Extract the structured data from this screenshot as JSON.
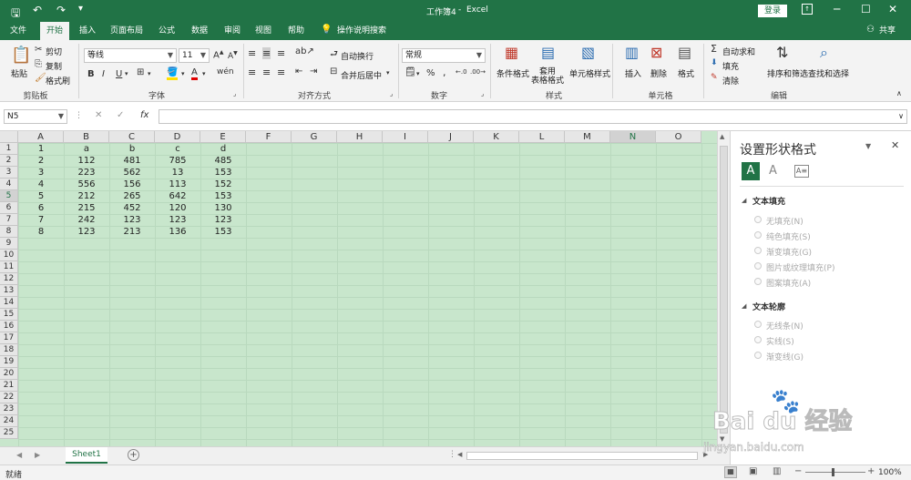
{
  "app": {
    "doc_title": "工作簿4",
    "app_name": "Excel",
    "login": "登录",
    "share": "共享"
  },
  "tabs": [
    "文件",
    "开始",
    "插入",
    "页面布局",
    "公式",
    "数据",
    "审阅",
    "视图",
    "帮助"
  ],
  "tell_me": "操作说明搜索",
  "ribbon": {
    "clipboard": {
      "paste": "粘贴",
      "cut": "剪切",
      "copy": "复制",
      "format_painter": "格式刷",
      "label": "剪贴板"
    },
    "font": {
      "name": "等线",
      "size": "11",
      "label": "字体",
      "bold": "B",
      "italic": "I",
      "underline": "U"
    },
    "alignment": {
      "wrap": "自动换行",
      "merge": "合并后居中",
      "label": "对齐方式"
    },
    "number": {
      "format": "常规",
      "label": "数字",
      "percent": "%"
    },
    "styles": {
      "conditional": "条件格式",
      "table": "套用\n表格格式",
      "cell_styles": "单元格样式",
      "label": "样式"
    },
    "cells": {
      "insert": "插入",
      "delete": "删除",
      "format": "格式",
      "label": "单元格"
    },
    "editing": {
      "autosum": "自动求和",
      "fill": "填充",
      "clear": "清除",
      "sort": "排序和筛选",
      "find": "查找和选择",
      "label": "编辑"
    }
  },
  "formula_bar": {
    "name_box": "N5",
    "fx": "fx",
    "value": ""
  },
  "columns": [
    "A",
    "B",
    "C",
    "D",
    "E",
    "F",
    "G",
    "H",
    "I",
    "J",
    "K",
    "L",
    "M",
    "N",
    "O"
  ],
  "rows": [
    "1",
    "2",
    "3",
    "4",
    "5",
    "6",
    "7",
    "8",
    "9",
    "10",
    "11",
    "12",
    "13",
    "14",
    "15",
    "16",
    "17",
    "18",
    "19",
    "20",
    "21",
    "22",
    "23",
    "24",
    "25"
  ],
  "table": [
    [
      "1",
      "a",
      "b",
      "c",
      "d"
    ],
    [
      "2",
      "112",
      "481",
      "785",
      "485"
    ],
    [
      "3",
      "223",
      "562",
      "13",
      "153"
    ],
    [
      "4",
      "556",
      "156",
      "113",
      "152"
    ],
    [
      "5",
      "212",
      "265",
      "642",
      "153"
    ],
    [
      "6",
      "215",
      "452",
      "120",
      "130"
    ],
    [
      "7",
      "242",
      "123",
      "123",
      "123"
    ],
    [
      "8",
      "123",
      "213",
      "136",
      "153"
    ]
  ],
  "active_cell": {
    "col": "N",
    "row": "5"
  },
  "sheet_tab": "Sheet1",
  "status": {
    "left": "就绪",
    "zoom": "100%"
  },
  "pane": {
    "title": "设置形状格式",
    "fill_section": "文本填充",
    "fill_options": [
      "无填充(N)",
      "纯色填充(S)",
      "渐变填充(G)",
      "图片或纹理填充(P)",
      "图案填充(A)"
    ],
    "outline_section": "文本轮廓",
    "outline_options": [
      "无线条(N)",
      "实线(S)",
      "渐变线(G)"
    ]
  },
  "watermark": {
    "brand": "Bai du 经验",
    "url": "jingyan.baidu.com"
  },
  "colors": {
    "accent": "#217346",
    "sheet_bg": "#c8e6cc"
  }
}
